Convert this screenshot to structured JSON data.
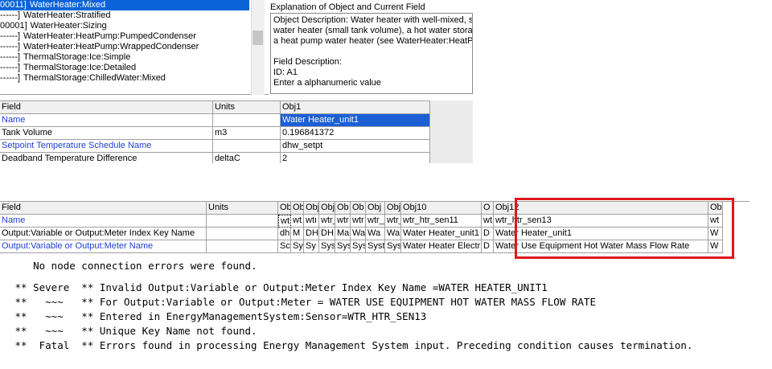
{
  "class_list": {
    "items": [
      {
        "prefix": "00011]",
        "label": "WaterHeater:Mixed",
        "selected": true
      },
      {
        "prefix": "------]",
        "label": "WaterHeater:Stratified",
        "selected": false
      },
      {
        "prefix": "00001]",
        "label": "WaterHeater:Sizing",
        "selected": false
      },
      {
        "prefix": "------]",
        "label": "WaterHeater:HeatPump:PumpedCondenser",
        "selected": false
      },
      {
        "prefix": "------]",
        "label": "WaterHeater:HeatPump:WrappedCondenser",
        "selected": false
      },
      {
        "prefix": "------]",
        "label": "ThermalStorage:Ice:Simple",
        "selected": false
      },
      {
        "prefix": "------]",
        "label": "ThermalStorage:Ice:Detailed",
        "selected": false
      },
      {
        "prefix": "------]",
        "label": "ThermalStorage:ChilledWater:Mixed",
        "selected": false
      }
    ]
  },
  "explanation": {
    "title": "Explanation of Object and Current Field",
    "lines": [
      "Object Description: Water heater with well-mixed, sin",
      "water heater (small tank volume), a hot water storage",
      "a heat pump water heater (see WaterHeater:HeatPu",
      "",
      "Field Description:",
      "ID: A1",
      "Enter a alphanumeric value"
    ]
  },
  "grid1": {
    "headers": [
      "Field",
      "Units",
      "Obj1"
    ],
    "rows": [
      {
        "field": "Name",
        "units": "",
        "value": "Water Heater_unit1",
        "blue": true,
        "selected": true
      },
      {
        "field": "Tank Volume",
        "units": "m3",
        "value": "0.196841372",
        "blue": false,
        "selected": false
      },
      {
        "field": "Setpoint Temperature Schedule Name",
        "units": "",
        "value": "dhw_setpt",
        "blue": true,
        "selected": false
      },
      {
        "field": "Deadband Temperature Difference",
        "units": "deltaC",
        "value": "2",
        "blue": false,
        "selected": false
      }
    ]
  },
  "grid2": {
    "headers": {
      "field": "Field",
      "units": "Units",
      "obj_narrow": [
        "Ob",
        "Ob",
        "Obj",
        "Obj",
        "Ob",
        "Ob",
        "Obj",
        "Obj"
      ],
      "obj10": "Obj10",
      "obj11": "O",
      "obj12": "Obj12",
      "obj13": "Ob"
    },
    "rows": [
      {
        "field": "Name",
        "blue": true,
        "narrow": [
          "wtı",
          "wt",
          "wtı",
          "wtr_",
          "wtr",
          "wtr",
          "wtr_",
          "wtr_"
        ],
        "obj10": "wtr_htr_sen11",
        "obj11": "wt",
        "obj12": "wtr_htr_sen13",
        "obj13": "wt"
      },
      {
        "field": "Output:Variable or Output:Meter Index Key Name",
        "blue": false,
        "narrow": [
          "dh",
          "M",
          "DH",
          "DH",
          "Ma",
          "Wa",
          "Wa",
          "Wa"
        ],
        "obj10": "Water Heater_unit1",
        "obj11": "D",
        "obj12": "Water Heater_unit1",
        "obj13": "W"
      },
      {
        "field": "Output:Variable or Output:Meter Name",
        "blue": true,
        "narrow": [
          "Sc",
          "Sy",
          "Sy",
          "Sys",
          "Sys",
          "Sys",
          "Syst",
          "Sys"
        ],
        "obj10": "Water Heater Electr",
        "obj11": "D",
        "obj12": "Water Use Equipment Hot Water Mass Flow Rate",
        "obj13": "W"
      }
    ]
  },
  "error_log": {
    "lines": [
      "    No node connection errors were found.",
      " ** Severe  ** Invalid Output:Variable or Output:Meter Index Key Name =WATER HEATER_UNIT1",
      " **   ~~~   ** For Output:Variable or Output:Meter = WATER USE EQUIPMENT HOT WATER MASS FLOW RATE",
      " **   ~~~   ** Entered in EnergyManagementSystem:Sensor=WTR_HTR_SEN13",
      " **   ~~~   ** Unique Key Name not found.",
      " **  Fatal  ** Errors found in processing Energy Management System input. Preceding condition causes termination."
    ]
  },
  "colors": {
    "selection": "#0a64d8",
    "field_blue": "#1f3fd9",
    "highlight_red": "#e0171d"
  }
}
